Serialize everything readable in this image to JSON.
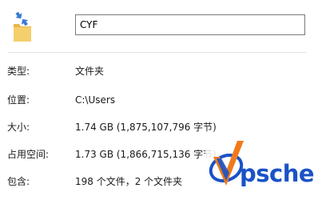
{
  "header": {
    "folder_name": "CYF"
  },
  "properties": [
    {
      "label": "类型:",
      "value": "文件夹"
    },
    {
      "label": "位置:",
      "value": "C:\\Users"
    },
    {
      "label": "大小:",
      "value": "1.74 GB (1,875,107,796 字节)"
    },
    {
      "label": "占用空间:",
      "value": "1.73 GB (1,866,715,136 字节)"
    },
    {
      "label": "包含:",
      "value": "198 个文件，2 个文件夹"
    }
  ],
  "watermark": {
    "text": "psche",
    "colors": {
      "brand_blue": "#1a52c7",
      "brand_orange": "#f07a1a"
    }
  },
  "icons": {
    "folder": "folder-shared-icon"
  }
}
